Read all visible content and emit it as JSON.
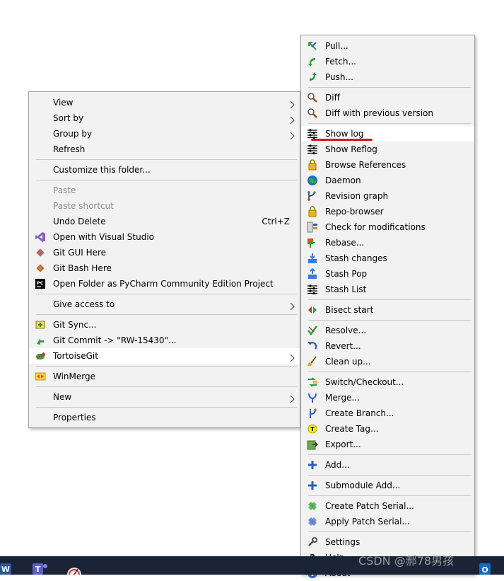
{
  "main_menu": [
    {
      "type": "item",
      "label": "View",
      "submenu": true
    },
    {
      "type": "item",
      "label": "Sort by",
      "submenu": true
    },
    {
      "type": "item",
      "label": "Group by",
      "submenu": true
    },
    {
      "type": "item",
      "label": "Refresh"
    },
    {
      "type": "sep"
    },
    {
      "type": "item",
      "label": "Customize this folder..."
    },
    {
      "type": "sep"
    },
    {
      "type": "item",
      "label": "Paste",
      "disabled": true
    },
    {
      "type": "item",
      "label": "Paste shortcut",
      "disabled": true
    },
    {
      "type": "item",
      "label": "Undo Delete",
      "shortcut": "Ctrl+Z"
    },
    {
      "type": "item",
      "label": "Open with Visual Studio",
      "icon": "visual-studio-icon"
    },
    {
      "type": "item",
      "label": "Git GUI Here",
      "icon": "git-gui-icon"
    },
    {
      "type": "item",
      "label": "Git Bash Here",
      "icon": "git-bash-icon"
    },
    {
      "type": "item",
      "label": "Open Folder as PyCharm Community Edition Project",
      "icon": "pycharm-icon"
    },
    {
      "type": "sep"
    },
    {
      "type": "item",
      "label": "Give access to",
      "submenu": true
    },
    {
      "type": "sep"
    },
    {
      "type": "item",
      "label": "Git Sync...",
      "icon": "git-sync-icon"
    },
    {
      "type": "item",
      "label": "Git Commit -> \"RW-15430\"...",
      "icon": "git-commit-icon"
    },
    {
      "type": "item",
      "label": "TortoiseGit",
      "icon": "tortoisegit-icon",
      "submenu": true,
      "highlighted": true
    },
    {
      "type": "sep"
    },
    {
      "type": "item",
      "label": "WinMerge",
      "icon": "winmerge-icon"
    },
    {
      "type": "sep"
    },
    {
      "type": "item",
      "label": "New",
      "submenu": true
    },
    {
      "type": "sep"
    },
    {
      "type": "item",
      "label": "Properties"
    }
  ],
  "sub_menu": [
    {
      "type": "item",
      "label": "Pull...",
      "icon": "pull-icon"
    },
    {
      "type": "item",
      "label": "Fetch...",
      "icon": "fetch-icon"
    },
    {
      "type": "item",
      "label": "Push...",
      "icon": "push-icon"
    },
    {
      "type": "sep"
    },
    {
      "type": "item",
      "label": "Diff",
      "icon": "diff-icon"
    },
    {
      "type": "item",
      "label": "Diff with previous version",
      "icon": "diff-previous-icon"
    },
    {
      "type": "sep"
    },
    {
      "type": "item",
      "label": "Show log",
      "icon": "show-log-icon",
      "highlighted": true
    },
    {
      "type": "item",
      "label": "Show Reflog",
      "icon": "show-reflog-icon"
    },
    {
      "type": "item",
      "label": "Browse References",
      "icon": "browse-references-icon"
    },
    {
      "type": "item",
      "label": "Daemon",
      "icon": "daemon-icon"
    },
    {
      "type": "item",
      "label": "Revision graph",
      "icon": "revision-graph-icon"
    },
    {
      "type": "item",
      "label": "Repo-browser",
      "icon": "repo-browser-icon"
    },
    {
      "type": "item",
      "label": "Check for modifications",
      "icon": "check-modifications-icon"
    },
    {
      "type": "item",
      "label": "Rebase...",
      "icon": "rebase-icon"
    },
    {
      "type": "item",
      "label": "Stash changes",
      "icon": "stash-changes-icon"
    },
    {
      "type": "item",
      "label": "Stash Pop",
      "icon": "stash-pop-icon"
    },
    {
      "type": "item",
      "label": "Stash List",
      "icon": "stash-list-icon"
    },
    {
      "type": "sep"
    },
    {
      "type": "item",
      "label": "Bisect start",
      "icon": "bisect-icon"
    },
    {
      "type": "sep"
    },
    {
      "type": "item",
      "label": "Resolve...",
      "icon": "resolve-icon"
    },
    {
      "type": "item",
      "label": "Revert...",
      "icon": "revert-icon"
    },
    {
      "type": "item",
      "label": "Clean up...",
      "icon": "clean-up-icon"
    },
    {
      "type": "sep"
    },
    {
      "type": "item",
      "label": "Switch/Checkout...",
      "icon": "switch-checkout-icon"
    },
    {
      "type": "item",
      "label": "Merge...",
      "icon": "merge-icon"
    },
    {
      "type": "item",
      "label": "Create Branch...",
      "icon": "create-branch-icon"
    },
    {
      "type": "item",
      "label": "Create Tag...",
      "icon": "create-tag-icon"
    },
    {
      "type": "item",
      "label": "Export...",
      "icon": "export-icon"
    },
    {
      "type": "sep"
    },
    {
      "type": "item",
      "label": "Add...",
      "icon": "add-icon"
    },
    {
      "type": "sep"
    },
    {
      "type": "item",
      "label": "Submodule Add...",
      "icon": "submodule-add-icon"
    },
    {
      "type": "sep"
    },
    {
      "type": "item",
      "label": "Create Patch Serial...",
      "icon": "create-patch-icon"
    },
    {
      "type": "item",
      "label": "Apply Patch Serial...",
      "icon": "apply-patch-icon"
    },
    {
      "type": "sep"
    },
    {
      "type": "item",
      "label": "Settings",
      "icon": "settings-icon"
    },
    {
      "type": "item",
      "label": "Help",
      "icon": "help-icon"
    },
    {
      "type": "item",
      "label": "About",
      "icon": "about-icon"
    }
  ],
  "watermark": "CSDN @郝78男孩"
}
